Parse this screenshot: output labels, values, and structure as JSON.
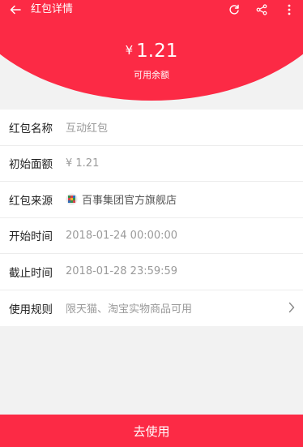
{
  "header": {
    "title": "红包详情",
    "icons": [
      "back-arrow-icon",
      "refresh-icon",
      "share-icon",
      "more-vert-icon"
    ]
  },
  "balance": {
    "currency": "¥",
    "amount": "1.21",
    "label": "可用余额"
  },
  "details": {
    "rows": [
      {
        "label": "红包名称",
        "value": "互动红包"
      },
      {
        "label": "初始面额",
        "value": "¥ 1.21"
      },
      {
        "label": "红包来源",
        "value": "百事集团官方旗舰店"
      },
      {
        "label": "开始时间",
        "value": "2018-01-24 00:00:00"
      },
      {
        "label": "截止时间",
        "value": "2018-01-28 23:59:59"
      },
      {
        "label": "使用规则",
        "value": "限天猫、淘宝实物商品可用"
      }
    ]
  },
  "footer": {
    "use_label": "去使用"
  },
  "colors": {
    "accent": "#fc2a45",
    "muted_text": "#9a9a9a"
  }
}
